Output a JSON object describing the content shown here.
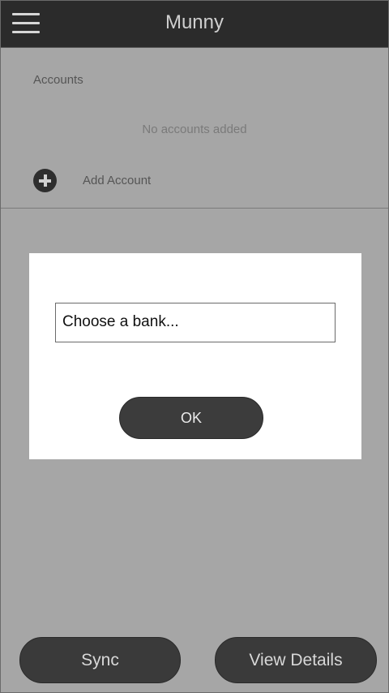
{
  "header": {
    "title": "Munny",
    "menu_icon": "hamburger-menu-icon"
  },
  "accounts": {
    "heading": "Accounts",
    "empty_message": "No accounts added",
    "add_label": "Add Account",
    "add_icon": "plus-circle-icon"
  },
  "dialog": {
    "bank_select_value": "Choose a bank...",
    "ok_label": "OK"
  },
  "footer": {
    "sync_label": "Sync",
    "view_details_label": "View Details"
  },
  "colors": {
    "titlebar": "#2b2b2b",
    "background": "#a6a6a6",
    "button": "#3a3a3a",
    "dialog": "#ffffff"
  }
}
